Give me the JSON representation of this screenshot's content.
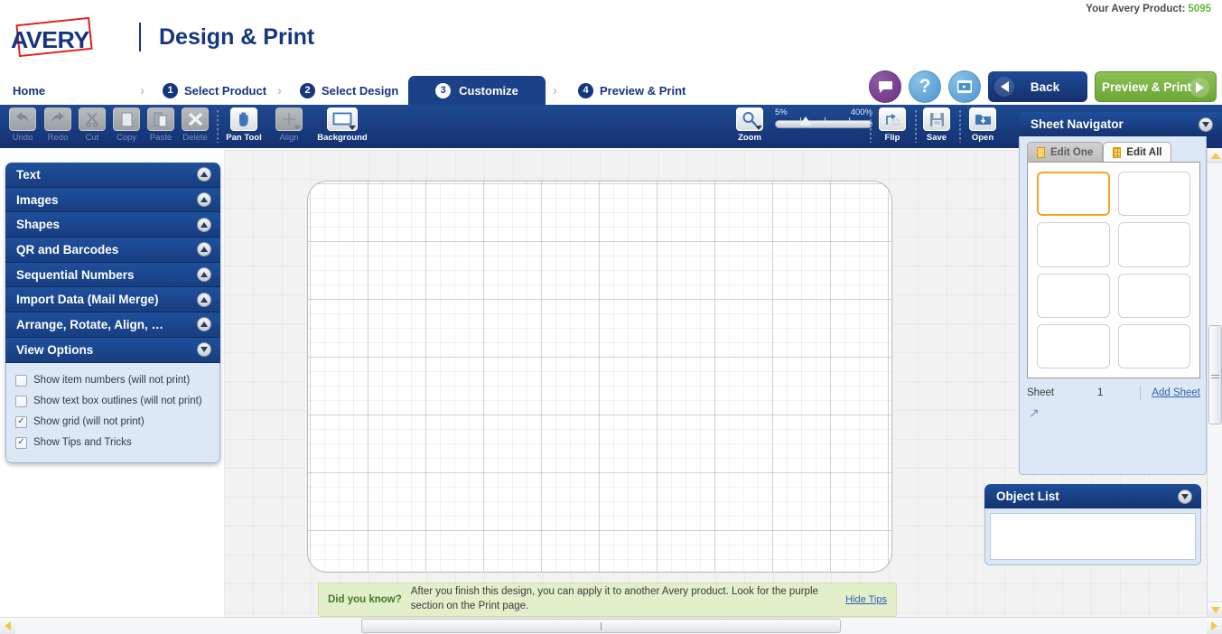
{
  "header": {
    "product_label": "Your Avery Product:",
    "product_number": "5095",
    "brand": "AVERY",
    "app_title": "Design & Print"
  },
  "breadcrumb": {
    "home": "Home",
    "steps": [
      {
        "num": "1",
        "label": "Select Product",
        "active": false
      },
      {
        "num": "2",
        "label": "Select Design",
        "active": false
      },
      {
        "num": "3",
        "label": "Customize",
        "active": true
      },
      {
        "num": "4",
        "label": "Preview & Print",
        "active": false
      }
    ]
  },
  "top_actions": {
    "chat_icon": "chat-bubble-icon",
    "help_icon": "question-mark-icon",
    "video_icon": "video-icon",
    "back_label": "Back",
    "preview_label": "Preview & Print"
  },
  "toolbar": {
    "items": [
      {
        "label": "Undo",
        "icon": "undo-arrow-icon",
        "enabled": false
      },
      {
        "label": "Redo",
        "icon": "redo-arrow-icon",
        "enabled": false
      },
      {
        "label": "Cut",
        "icon": "scissors-icon",
        "enabled": false
      },
      {
        "label": "Copy",
        "icon": "copy-icon",
        "enabled": false
      },
      {
        "label": "Paste",
        "icon": "clipboard-icon",
        "enabled": false
      },
      {
        "label": "Delete",
        "icon": "x-icon",
        "enabled": false
      },
      {
        "label": "Pan Tool",
        "icon": "hand-icon",
        "enabled": true
      },
      {
        "label": "Align",
        "icon": "crosshair-icon",
        "enabled": false
      },
      {
        "label": "Background",
        "icon": "rectangle-icon",
        "enabled": true
      }
    ],
    "zoom": {
      "label": "Zoom",
      "icon": "magnifier-icon",
      "min_label": "5%",
      "max_label": "400%"
    },
    "flip": {
      "label": "Flip",
      "icon": "flip-icon"
    },
    "save": {
      "label": "Save",
      "icon": "floppy-disk-icon"
    },
    "open": {
      "label": "Open",
      "icon": "folder-open-icon"
    }
  },
  "sidebar": {
    "sections": [
      {
        "label": "Text",
        "expanded": false
      },
      {
        "label": "Images",
        "expanded": false
      },
      {
        "label": "Shapes",
        "expanded": false
      },
      {
        "label": "QR and Barcodes",
        "expanded": false
      },
      {
        "label": "Sequential Numbers",
        "expanded": false
      },
      {
        "label": "Import Data (Mail Merge)",
        "expanded": false
      },
      {
        "label": "Arrange, Rotate, Align, …",
        "expanded": false
      },
      {
        "label": "View Options",
        "expanded": true
      }
    ],
    "view_options": [
      {
        "label": "Show item numbers (will not print)",
        "checked": false
      },
      {
        "label": "Show text box outlines (will not print)",
        "checked": false
      },
      {
        "label": "Show grid (will not print)",
        "checked": true
      },
      {
        "label": "Show Tips and Tricks",
        "checked": true
      }
    ]
  },
  "sheet_navigator": {
    "title": "Sheet Navigator",
    "tabs": [
      {
        "label": "Edit One",
        "active": false,
        "icon": "single-label-icon"
      },
      {
        "label": "Edit All",
        "active": true,
        "icon": "grid-label-icon"
      }
    ],
    "cells": 8,
    "selected_cell": 1,
    "sheet_label": "Sheet",
    "sheet_value": "1",
    "add_sheet_label": "Add Sheet"
  },
  "object_list": {
    "title": "Object List",
    "items": []
  },
  "tip": {
    "title": "Did you know?",
    "text": "After you finish this design, you can apply it to another Avery product.  Look for the purple section on the Print page.",
    "hide_label": "Hide Tips"
  },
  "colors": {
    "brand_blue": "#15357f",
    "toolbar_blue": "#1b4288",
    "accent_green": "#6ba636",
    "selection_orange": "#f5a623",
    "tip_green_bg": "#e3eecb"
  }
}
